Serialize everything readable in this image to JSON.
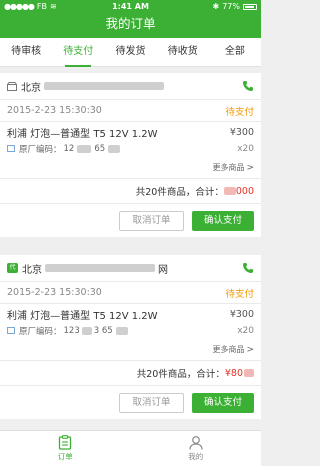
{
  "status_bar": {
    "carrier": "FB",
    "time": "1:41 AM",
    "battery": "77%"
  },
  "header": {
    "title": "我的订单"
  },
  "tabs": [
    {
      "label": "待审核"
    },
    {
      "label": "待支付"
    },
    {
      "label": "待发货"
    },
    {
      "label": "待收货"
    },
    {
      "label": "全部"
    }
  ],
  "orders": [
    {
      "shop_name": "北京",
      "date": "2015-2-23 15:30:30",
      "status": "待支付",
      "product_name": "利浦  灯泡—普通型 T5 12V 1.2W",
      "price": "¥300",
      "code_label": "原厂编码：",
      "code_value": "12",
      "code_value_2": "65",
      "quantity": "x20",
      "more": "更多商品",
      "total_label": "共20件商品，合计：",
      "total_value": "000",
      "cancel_label": "取消订单",
      "confirm_label": "确认支付"
    },
    {
      "shop_name": "北京",
      "shop_name_suffix": "网",
      "date": "2015-2-23 15:30:30",
      "status": "待支付",
      "product_name": "利浦  灯泡—普通型 T5 12V 1.2W",
      "price": "¥300",
      "code_label": "原厂编码：",
      "code_value": "123",
      "code_value_2": "3 65",
      "quantity": "x20",
      "more": "更多商品",
      "total_label": "共20件商品，合计：",
      "total_value": "¥80",
      "cancel_label": "取消订单",
      "confirm_label": "确认支付"
    }
  ],
  "bottom_nav": [
    {
      "label": "订单",
      "icon": "order-icon"
    },
    {
      "label": "我的",
      "icon": "person-icon"
    }
  ],
  "colors": {
    "brand_green": "#3cb034",
    "status_orange": "#f39800",
    "price_red": "#e5332a"
  }
}
